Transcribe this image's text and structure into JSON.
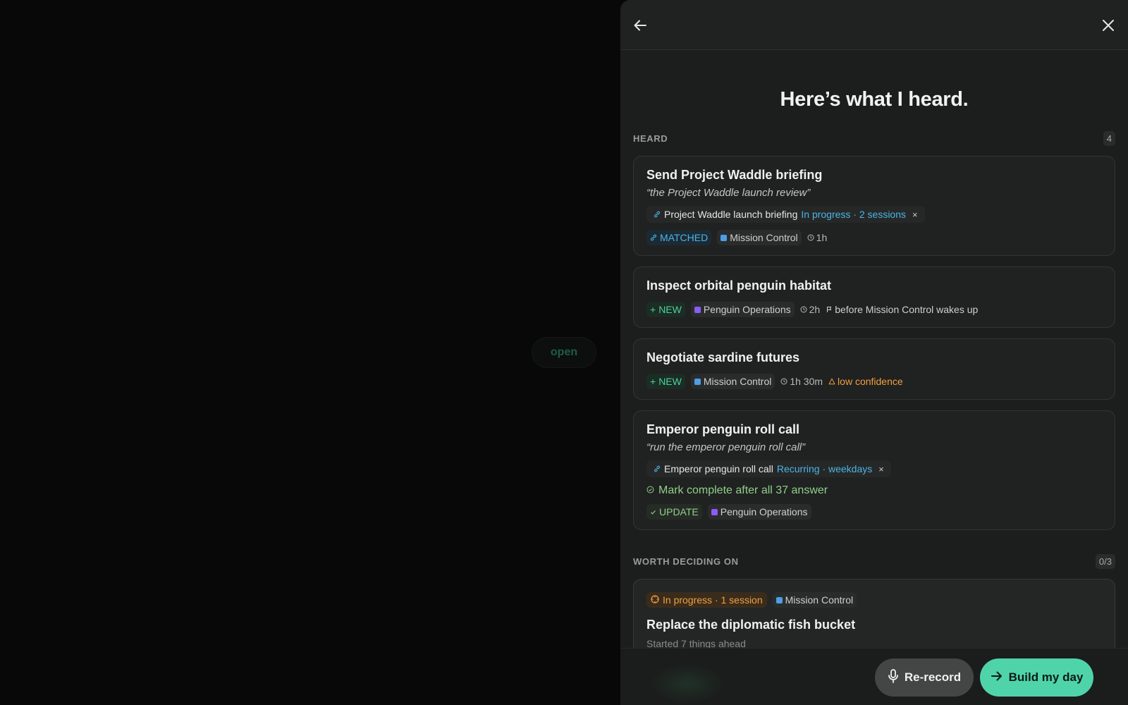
{
  "backdrop": {
    "open_label": "open"
  },
  "panel": {
    "title": "Here’s what I heard.",
    "heard": {
      "label": "HEARD",
      "count": "4",
      "items": [
        {
          "title": "Send Project Waddle briefing",
          "quote": "“the Project Waddle launch review”",
          "link": {
            "name": "Project Waddle launch briefing",
            "status": "In progress · 2 sessions",
            "remove": "×"
          },
          "tag": "MATCHED",
          "area": "Mission Control",
          "duration": "1h"
        },
        {
          "title": "Inspect orbital penguin habitat",
          "tag": "NEW",
          "area": "Penguin Operations",
          "duration": "2h",
          "deadline": "before Mission Control wakes up"
        },
        {
          "title": "Negotiate sardine futures",
          "tag": "NEW",
          "area": "Mission Control",
          "duration": "1h 30m",
          "warning": "low confidence"
        },
        {
          "title": "Emperor penguin roll call",
          "quote": "“run the emperor penguin roll call”",
          "link": {
            "name": "Emperor penguin roll call",
            "status": "Recurring · weekdays",
            "remove": "×"
          },
          "mark": "Mark complete after all 37 answer",
          "tag": "UPDATE",
          "area": "Penguin Operations"
        }
      ]
    },
    "worth": {
      "label": "WORTH DECIDING ON",
      "count": "0/3",
      "items": [
        {
          "status": "In progress · 1 session",
          "area": "Mission Control",
          "title": "Replace the diplomatic fish bucket",
          "subtitle": "Started 7 things ahead"
        }
      ]
    },
    "footer": {
      "rerecord_label": "Re-record",
      "build_label": "Build my day"
    }
  },
  "colors": {
    "accent": "#4fd4aa",
    "link_blue": "#4cb4e6",
    "warning": "#f0a040",
    "mission_control": "#4c9ee6",
    "penguin_operations": "#8b5cf6"
  }
}
